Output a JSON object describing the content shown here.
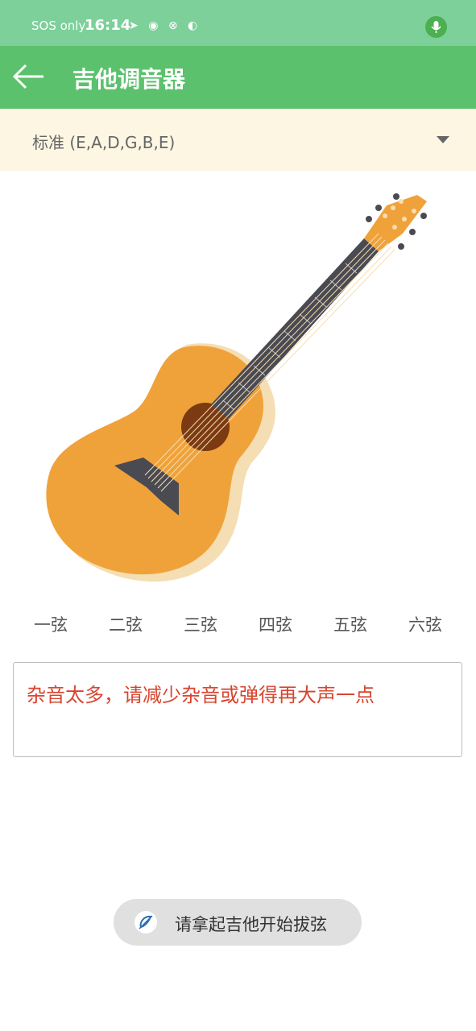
{
  "status_bar": {
    "carrier": "SOS only",
    "time": "16:14",
    "icons": [
      "telegram-icon",
      "game-icon",
      "vpn-icon",
      "app-icon"
    ],
    "mic_icon": "mic-icon"
  },
  "app_bar": {
    "title": "吉他调音器",
    "back_icon": "back-arrow-icon"
  },
  "tuning": {
    "selected": "标准 (E,A,D,G,B,E)"
  },
  "strings": [
    "一弦",
    "二弦",
    "三弦",
    "四弦",
    "五弦",
    "六弦"
  ],
  "message": "杂音太多，请减少杂音或弹得再大声一点",
  "prompt": {
    "text": "请拿起吉他开始拔弦",
    "icon": "guitar-pick-icon"
  },
  "colors": {
    "status_bar": "#7dd09a",
    "app_bar": "#5cc16d",
    "tuning_bg": "#fdf6e3",
    "message_text": "#d7452f",
    "guitar_body": "#f0a23a",
    "guitar_shadow": "#f5deb3",
    "sound_hole": "#7b3a12",
    "fretboard": "#4a4a52"
  }
}
